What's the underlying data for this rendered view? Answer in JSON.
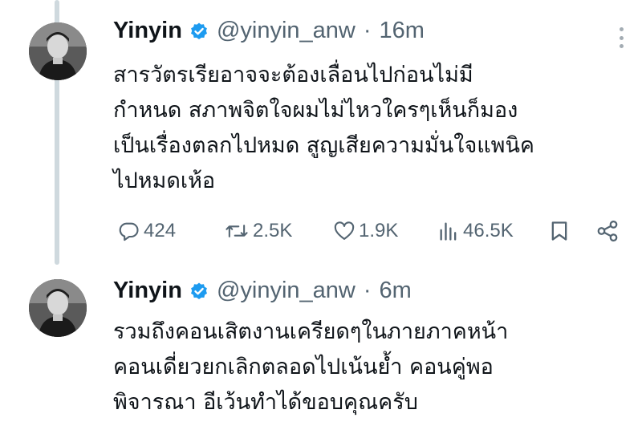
{
  "tweets": [
    {
      "display_name": "Yinyin",
      "handle": "@yinyin_anw",
      "separator": "·",
      "time": "16m",
      "text": "สารวัตรเรียอาจจะต้องเลื่อนไปก่อนไม่มี\nกำหนด สภาพจิตใจผมไม่ไหวใครๆเห็นก็มอง\nเป็นเรื่องตลกไปหมด สูญเสียความมั่นใจแพนิค\nไปหมดเห้อ",
      "stats": {
        "replies": "424",
        "retweets": "2.5K",
        "likes": "1.9K",
        "views": "46.5K"
      }
    },
    {
      "display_name": "Yinyin",
      "handle": "@yinyin_anw",
      "separator": "·",
      "time": "6m",
      "text": "รวมถึงคอนเสิตงานเครียดๆในภายภาคหน้า\nคอนเดี่ยวยกเลิกตลอดไปเน้นย้ำ คอนคู่พอ\nพิจารณา อีเว้นทำได้ขอบคุณครับ"
    }
  ],
  "icons": {
    "verified": "verified-badge-icon",
    "more": "more-options-icon",
    "reply": "reply-icon",
    "retweet": "retweet-icon",
    "like": "like-icon",
    "views": "views-icon",
    "bookmark": "bookmark-icon",
    "share": "share-icon"
  },
  "colors": {
    "verified": "#1d9bf0",
    "secondary_text": "#536471",
    "thread_line": "#cfd9de"
  }
}
